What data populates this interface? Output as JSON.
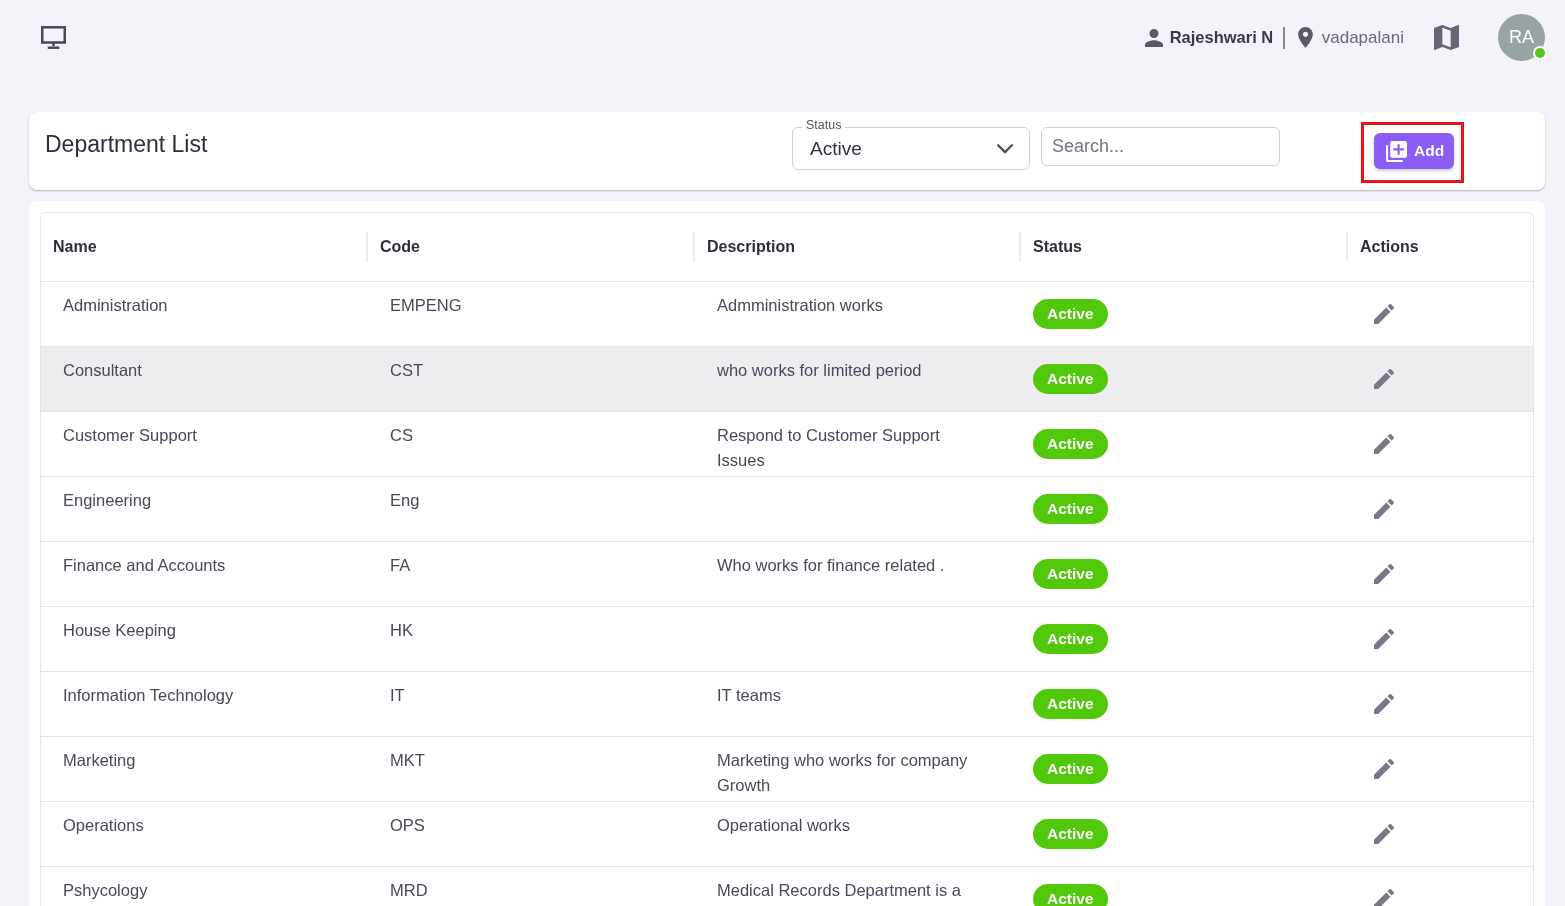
{
  "top_bar": {
    "user_name": "Rajeshwari N",
    "location": "vadapalani",
    "avatar": {
      "initials": "RA",
      "online": true
    }
  },
  "header": {
    "title": "Department List",
    "status_filter": {
      "label": "Status",
      "value": "Active"
    },
    "search": {
      "placeholder": "Search..."
    },
    "add_button": {
      "label": "Add",
      "highlighted": true
    }
  },
  "table": {
    "columns": [
      "Name",
      "Code",
      "Description",
      "Status",
      "Actions"
    ],
    "rows": [
      {
        "name": "Administration",
        "code": "EMPENG",
        "description": "Admministration works",
        "status": "Active",
        "highlighted": false
      },
      {
        "name": "Consultant",
        "code": "CST",
        "description": "who works for limited period",
        "status": "Active",
        "highlighted": true
      },
      {
        "name": "Customer Support",
        "code": "CS",
        "description": "Respond to Customer Support Issues",
        "status": "Active",
        "highlighted": false
      },
      {
        "name": "Engineering",
        "code": "Eng",
        "status": "Active",
        "highlighted": false
      },
      {
        "name": "Finance and Accounts",
        "code": "FA",
        "description": "Who works for finance related .",
        "status": "Active",
        "highlighted": false
      },
      {
        "name": "House Keeping",
        "code": "HK",
        "status": "Active",
        "highlighted": false
      },
      {
        "name": "Information Technology",
        "code": "IT",
        "description": "IT teams",
        "status": "Active",
        "highlighted": false
      },
      {
        "name": "Marketing",
        "code": "MKT",
        "description": "Marketing who works for company Growth",
        "status": "Active",
        "highlighted": false
      },
      {
        "name": "Operations",
        "code": "OPS",
        "description": "Operational works",
        "status": "Active",
        "highlighted": false
      },
      {
        "name": "Pshycology",
        "code": "MRD",
        "description": "Medical Records Department is a",
        "status": "Active",
        "highlighted": false
      }
    ]
  }
}
